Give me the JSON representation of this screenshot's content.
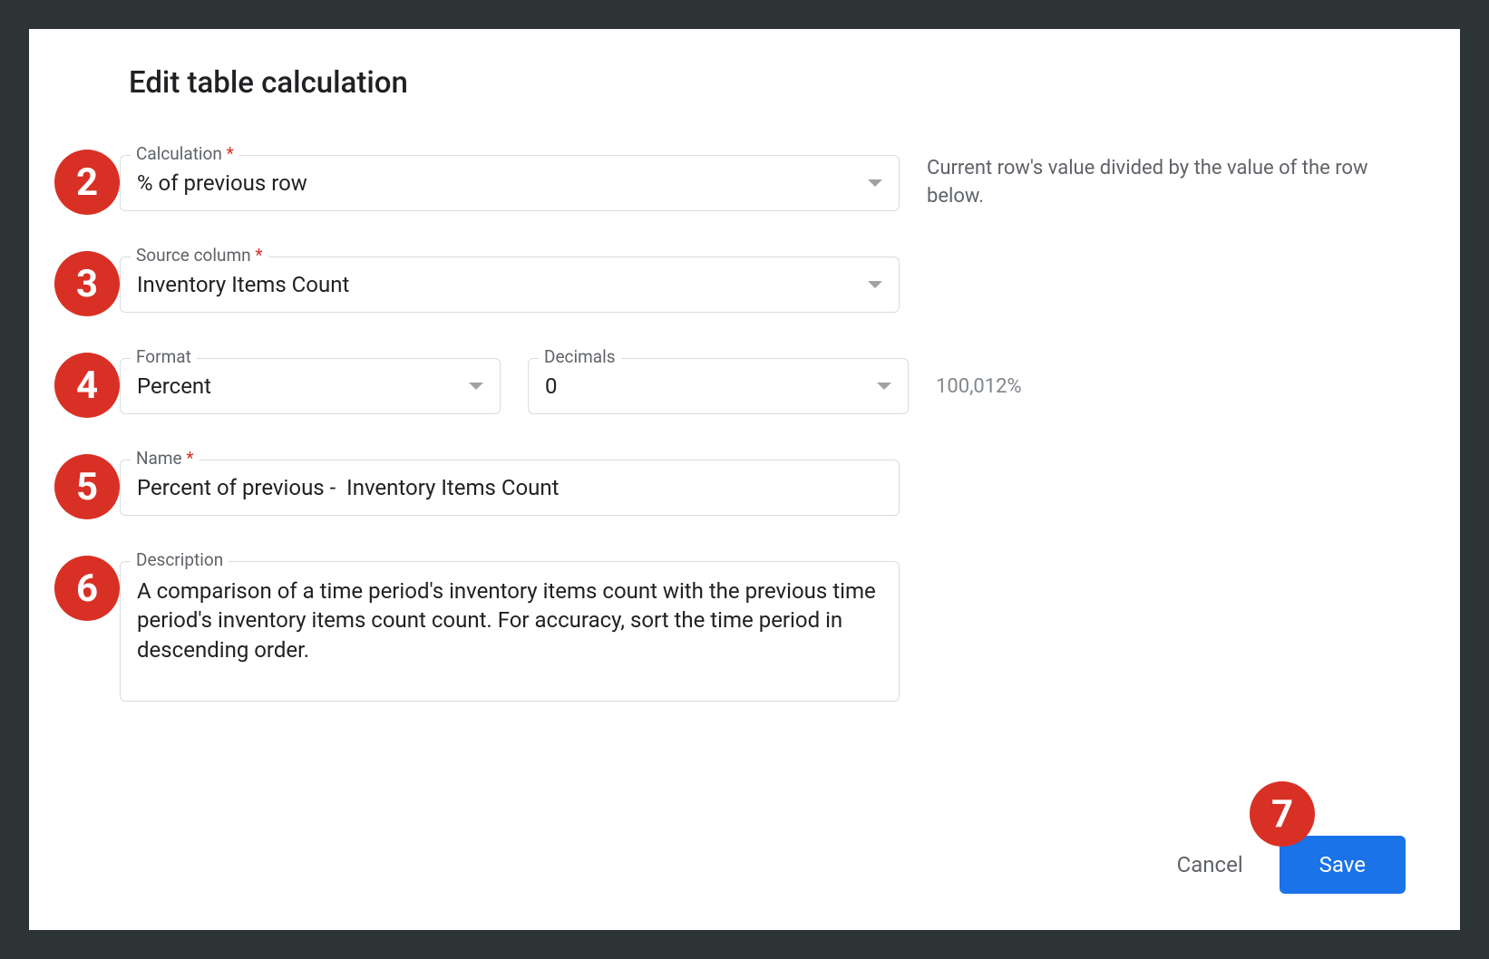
{
  "dialog": {
    "title": "Edit table calculation"
  },
  "fields": {
    "calculation": {
      "label": "Calculation",
      "value": "% of previous row",
      "helper": "Current row's value divided by the value of the row below."
    },
    "source_column": {
      "label": "Source column",
      "value": "Inventory Items Count"
    },
    "format": {
      "label": "Format",
      "value": "Percent"
    },
    "decimals": {
      "label": "Decimals",
      "value": "0"
    },
    "format_hint": "100,012%",
    "name": {
      "label": "Name",
      "value": "Percent of previous -  Inventory Items Count"
    },
    "description": {
      "label": "Description",
      "value": "A comparison of a time period's inventory items count with the previous time period's inventory items count count. For accuracy, sort the time period in descending order."
    }
  },
  "actions": {
    "cancel": "Cancel",
    "save": "Save"
  },
  "badges": {
    "calculation": "2",
    "source_column": "3",
    "format": "4",
    "name": "5",
    "description": "6",
    "save": "7"
  }
}
